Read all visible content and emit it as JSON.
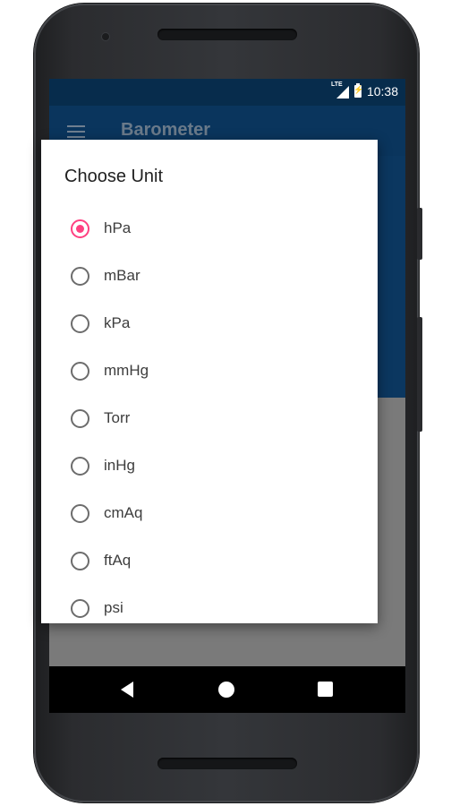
{
  "status_bar": {
    "time": "10:38",
    "network_label": "LTE"
  },
  "app_bar": {
    "title": "Barometer",
    "menu_icon": "hamburger-menu-icon"
  },
  "dialog": {
    "title": "Choose Unit",
    "options": [
      {
        "label": "hPa",
        "selected": true
      },
      {
        "label": "mBar",
        "selected": false
      },
      {
        "label": "kPa",
        "selected": false
      },
      {
        "label": "mmHg",
        "selected": false
      },
      {
        "label": "Torr",
        "selected": false
      },
      {
        "label": "inHg",
        "selected": false
      },
      {
        "label": "cmAq",
        "selected": false
      },
      {
        "label": "ftAq",
        "selected": false
      },
      {
        "label": "psi",
        "selected": false
      }
    ]
  },
  "colors": {
    "accent": "#ff4081",
    "primary_dark": "#072c4c",
    "primary": "#0a355d"
  },
  "nav_bar": {
    "icons": [
      "back-icon",
      "home-icon",
      "recent-apps-icon"
    ]
  }
}
